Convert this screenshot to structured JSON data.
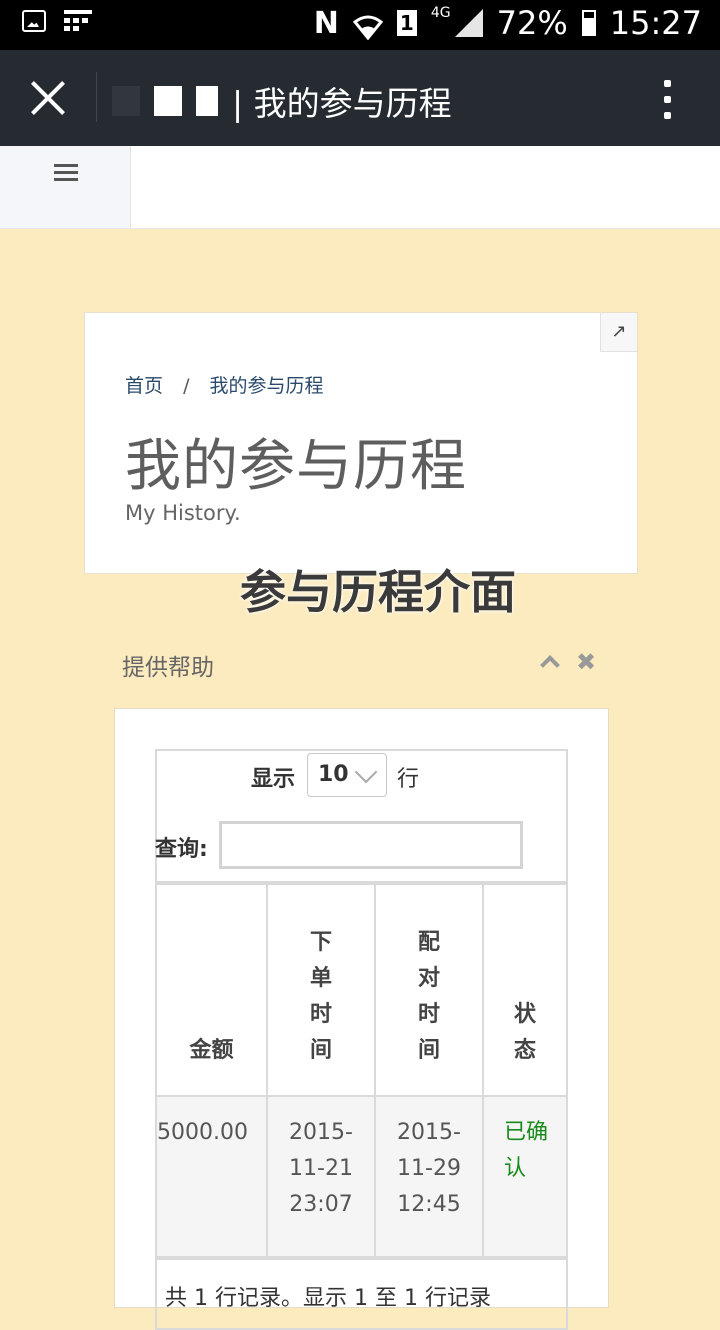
{
  "status_bar": {
    "battery": "72%",
    "time": "15:27",
    "network": "4G",
    "sim": "1"
  },
  "app_bar": {
    "title": "| 我的参与历程"
  },
  "header": {
    "breadcrumb": [
      "首页",
      "我的参与历程"
    ],
    "breadcrumb_sep": "/",
    "title": "我的参与历程",
    "subtitle": "My History."
  },
  "watermark": "参与历程介面",
  "portlet": {
    "title": "提供帮助",
    "length_label": "显示",
    "length_value": "10",
    "length_suffix": "行",
    "search_label": "查询:",
    "columns": [
      "金额",
      "下单时间",
      "配对时间",
      "状态"
    ],
    "rows": [
      {
        "amount": "5000.00",
        "order_time": "2015-11-21 23:07",
        "match_time": "2015-11-29 12:45",
        "status": "已确认"
      }
    ],
    "info": "共 1 行记录。显示 1 至 1 行记录"
  },
  "colors": {
    "page_bg": "#fcebbf",
    "app_bar": "#262b31",
    "status_confirmed": "#1a8a1a"
  },
  "icons": [
    "close-icon",
    "more-vert-icon",
    "menu-icon",
    "expand-icon",
    "collapse-icon",
    "remove-icon",
    "chevron-down-icon"
  ]
}
